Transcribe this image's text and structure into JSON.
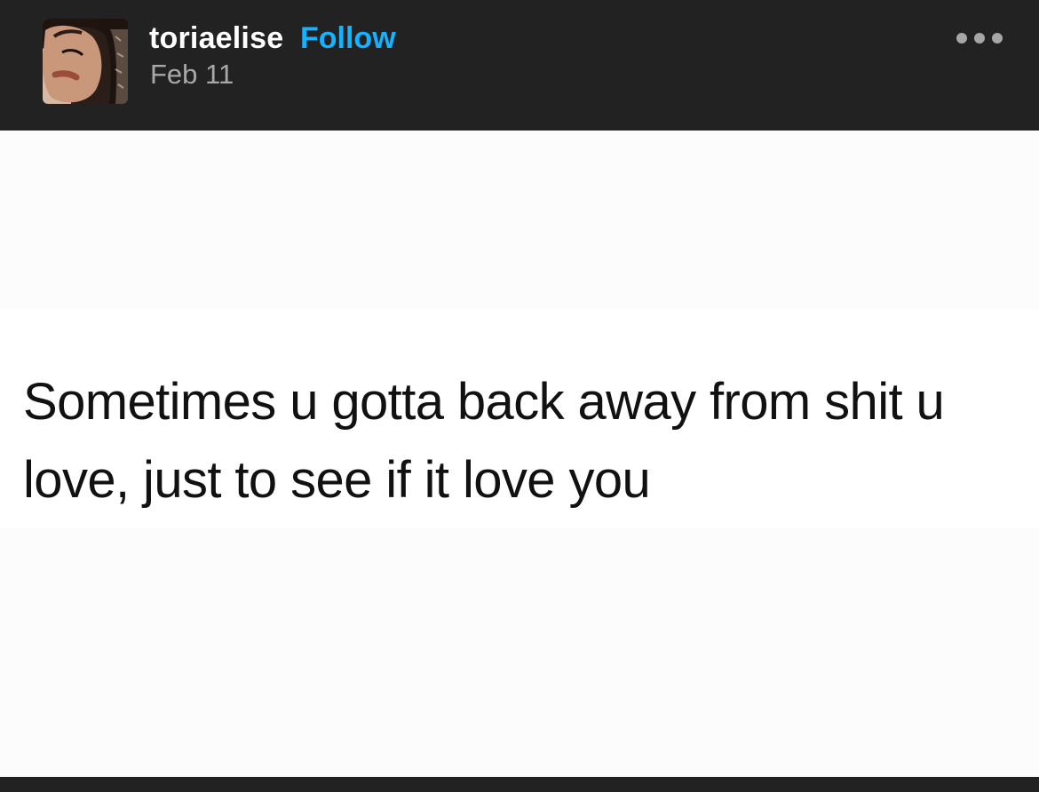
{
  "post": {
    "author": {
      "username": "toriaelise",
      "avatar_icon": "avatar-photo"
    },
    "follow_label": "Follow",
    "date": "Feb 11",
    "more_icon": "more-dots-icon",
    "image_text": "Sometimes u gotta back away from shit u love, just to see if it love you"
  },
  "colors": {
    "header_background": "#222222",
    "follow_link": "#16b1ff",
    "date_text": "#a8a8a8",
    "post_background": "#fcfcfc"
  }
}
